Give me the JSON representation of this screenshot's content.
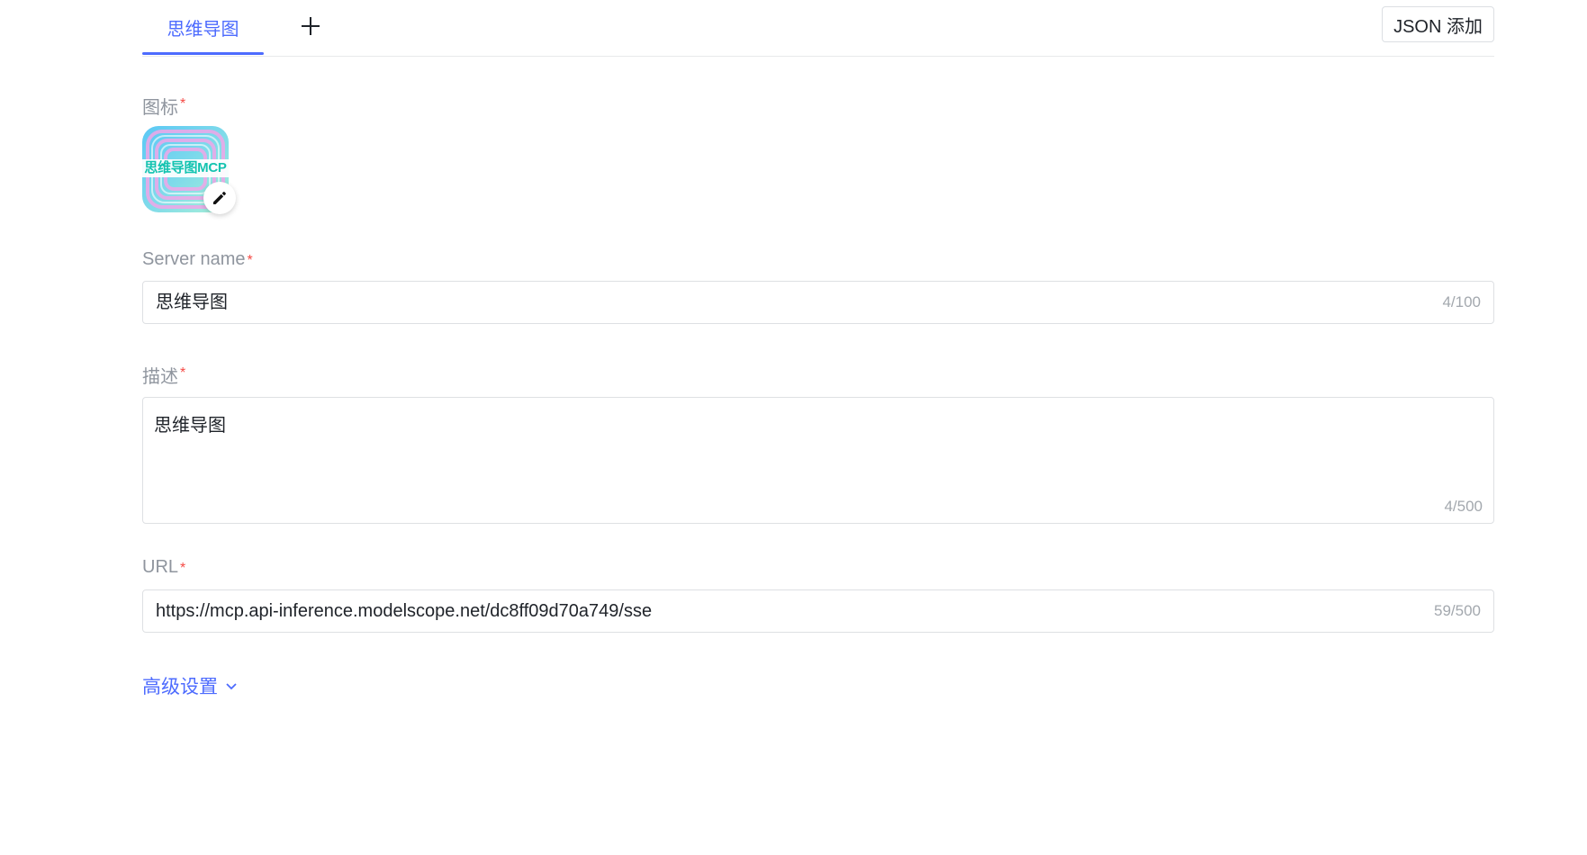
{
  "tabs": {
    "items": [
      {
        "label": "思维导图",
        "active": true
      }
    ],
    "add_icon": "plus-icon"
  },
  "toolbar": {
    "json_add_label": "JSON 添加"
  },
  "form": {
    "icon": {
      "label": "图标",
      "required_mark": "*",
      "image_text": "思维导图MCP",
      "edit_icon": "pencil-icon"
    },
    "server_name": {
      "label": "Server name",
      "required_mark": "*",
      "value": "思维导图",
      "count": "4/100"
    },
    "description": {
      "label": "描述",
      "required_mark": "*",
      "value": "思维导图",
      "count": "4/500"
    },
    "url": {
      "label": "URL",
      "required_mark": "*",
      "value": "https://mcp.api-inference.modelscope.net/dc8ff09d70a749/sse",
      "count": "59/500"
    },
    "advanced": {
      "label": "高级设置",
      "icon": "chevron-down-icon"
    }
  },
  "colors": {
    "accent": "#4d6bfe",
    "required": "#f54a45",
    "label": "#8f959e",
    "border": "#dee0e3"
  }
}
